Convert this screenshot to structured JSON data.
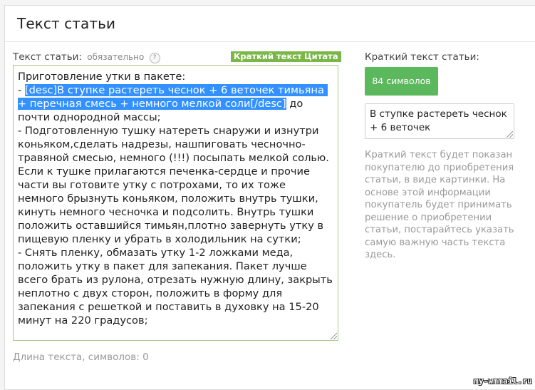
{
  "panel": {
    "title": "Текст статьи"
  },
  "article_field": {
    "label": "Текст статьи:",
    "required_text": "обязательно",
    "help_icon_text": "?",
    "buttons": {
      "short_text": "Краткий текст",
      "quote": "Цитата"
    },
    "text_before": "Приготовление утки в пакете:\n- ",
    "selected_text": "[desc]В ступке растереть чеснок + 6 веточек тимьяна + перечная смесь + немного мелкой соли[/desc]",
    "text_after": " до почти однородной массы;\n- Подготовленную тушку натереть снаружи и изнутри коньяком,сделать надрезы, нашпиговать чесночно-травяной смесью, немного (!!!) посыпать мелкой солью. Если к тушке прилагаются печенка-сердце и прочие части вы готовите утку с потрохами, то их тоже немного брызнуть коньяком, положить внутрь тушки, кинуть немного чесночка и подсолить. Внутрь тушки положить оставшийся тимьян,плотно завернуть утку в пищевую пленку и убрать в холодильник на сутки;\n- Снять пленку, обмазать утку 1-2 ложками меда, положить утку в пакет для запекания. Пакет лучше всего брать из рулона, отрезать нужную длину, закрыть неплотно с двух сторон, положить в форму для запекания с решеткой и поставить в духовку на 15-20 минут на 220 градусов;",
    "length_label": "Длина текста, символов: 0"
  },
  "short_text_field": {
    "label": "Краткий текст статьи:",
    "char_count": "84 символов",
    "value": "В ступке растереть чеснок + 6 веточек",
    "hint": "Краткий текст будет показан покупателю до приобретения статьи, в виде картинки. На основе этой информации покупатель будет принимать решение о приобретении статьи, постарайтесь указать самую важную часть текста здесь."
  },
  "watermark": "my-wmmail.ru",
  "colors": {
    "accent_green": "#7ab648",
    "count_badge": "#5cb85c",
    "selection": "#3390ff",
    "editor_border": "#a9c98a"
  }
}
